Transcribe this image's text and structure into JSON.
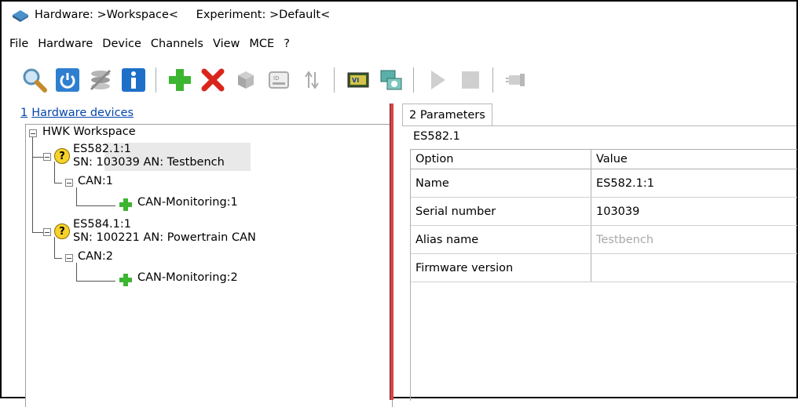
{
  "window": {
    "title_parts": [
      "Hardware: >Workspace<",
      "Experiment: >Default<"
    ]
  },
  "menu": [
    "File",
    "Hardware",
    "Device",
    "Channels",
    "View",
    "MCE",
    "?"
  ],
  "toolbar": {
    "icons": [
      "search-icon",
      "power-icon",
      "disconnect-icon",
      "info-icon",
      "add-icon",
      "delete-icon",
      "cube-icon",
      "id-icon",
      "sort-icon",
      "chip-icon",
      "network-icon",
      "play-icon",
      "stop-icon",
      "plug-icon"
    ]
  },
  "left": {
    "header_number": "1",
    "header_label": "Hardware devices",
    "tree": {
      "root": "HWK Workspace",
      "devices": [
        {
          "name": "ES582.1:1",
          "detail": "SN: 103039 AN: Testbench",
          "channel": "CAN:1",
          "monitor": "CAN-Monitoring:1"
        },
        {
          "name": "ES584.1:1",
          "detail": "SN: 100221 AN: Powertrain CAN",
          "channel": "CAN:2",
          "monitor": "CAN-Monitoring:2"
        }
      ]
    }
  },
  "right": {
    "tab_label": "2 Parameters",
    "device": "ES582.1",
    "columns": [
      "Option",
      "Value"
    ],
    "rows": [
      {
        "option": "Name",
        "value": "ES582.1:1"
      },
      {
        "option": "Serial number",
        "value": "103039"
      },
      {
        "option": "Alias name",
        "value": "Testbench"
      },
      {
        "option": "Firmware version",
        "value": ""
      }
    ]
  },
  "colors": {
    "splitter": "#d64545",
    "link": "#0645ad",
    "selected_row": "#e9e9e9",
    "warning_icon": "#f7d22a",
    "add_green": "#3cb531",
    "delete_red": "#d9261c"
  }
}
